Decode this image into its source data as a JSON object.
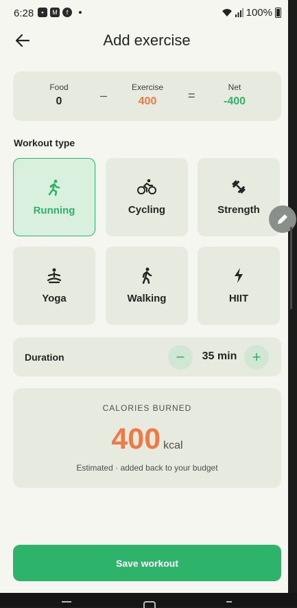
{
  "status": {
    "time": "6:28",
    "battery": "100%"
  },
  "header": {
    "title": "Add exercise"
  },
  "summary": {
    "food_label": "Food",
    "food_value": "0",
    "minus": "–",
    "exercise_label": "Exercise",
    "exercise_value": "400",
    "equals": "=",
    "net_label": "Net",
    "net_value": "-400"
  },
  "workout": {
    "section_label": "Workout type",
    "selected": "Running",
    "items": [
      {
        "label": "Running",
        "icon": "running-icon"
      },
      {
        "label": "Cycling",
        "icon": "cycling-icon"
      },
      {
        "label": "Strength",
        "icon": "dumbbell-icon"
      },
      {
        "label": "Yoga",
        "icon": "yoga-icon"
      },
      {
        "label": "Walking",
        "icon": "walking-icon"
      },
      {
        "label": "HIIT",
        "icon": "bolt-icon"
      }
    ]
  },
  "duration": {
    "label": "Duration",
    "value": "35 min",
    "decrement": "−",
    "increment": "+"
  },
  "calories": {
    "heading": "CALORIES BURNED",
    "value": "400",
    "unit": "kcal",
    "note": "Estimated · added back to your budget"
  },
  "save_label": "Save workout",
  "colors": {
    "accent": "#2eb36b",
    "calories": "#f07a45",
    "card": "#e7eadf",
    "background": "#f4f6ef"
  }
}
